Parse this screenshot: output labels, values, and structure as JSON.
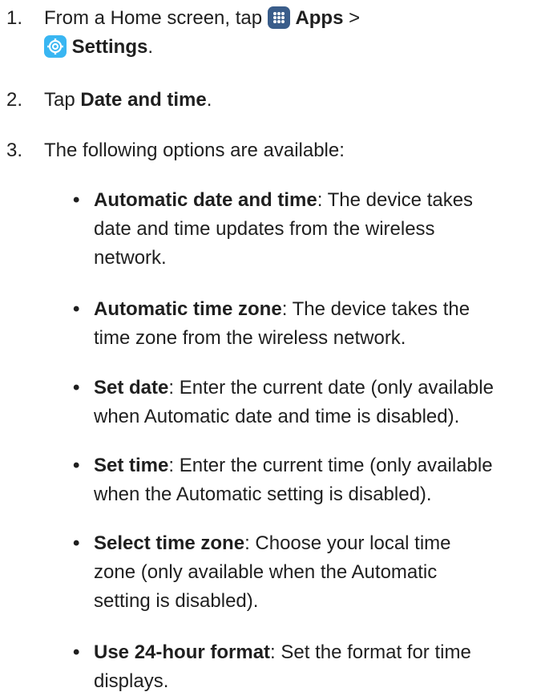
{
  "steps": [
    {
      "number": "1.",
      "lead": "From a Home screen, tap ",
      "apps_label": "Apps",
      "separator": " >",
      "settings_label": "Settings",
      "end": "."
    },
    {
      "number": "2.",
      "lead": "Tap ",
      "bold": "Date and time",
      "end": "."
    },
    {
      "number": "3.",
      "text": "The following options are available:"
    }
  ],
  "options": [
    {
      "term": "Automatic date and time",
      "desc_lines": [
        ": The device takes",
        "date and time updates from the wireless",
        "network."
      ]
    },
    {
      "term": "Automatic time zone",
      "desc_lines": [
        ": The device takes the",
        "time zone from the wireless network."
      ]
    },
    {
      "term": "Set date",
      "desc_lines": [
        ": Enter the current date (only available",
        "when Automatic date and time is disabled)."
      ]
    },
    {
      "term": "Set time",
      "desc_lines": [
        ": Enter the current time (only available",
        "when the Automatic setting is disabled)."
      ]
    },
    {
      "term": "Select time zone",
      "desc_lines": [
        ": Choose your local time",
        "zone (only available when the Automatic",
        "setting is disabled)."
      ]
    },
    {
      "term": "Use 24-hour format",
      "desc_lines": [
        ": Set the format for time",
        "displays."
      ]
    }
  ],
  "bullet_glyph": "•",
  "icons": {
    "apps": "apps-grid-icon",
    "settings": "settings-gear-icon"
  },
  "colors": {
    "apps_icon": "#3a5d8a",
    "settings_icon": "#39b6f2",
    "text": "#1f1f1f"
  }
}
